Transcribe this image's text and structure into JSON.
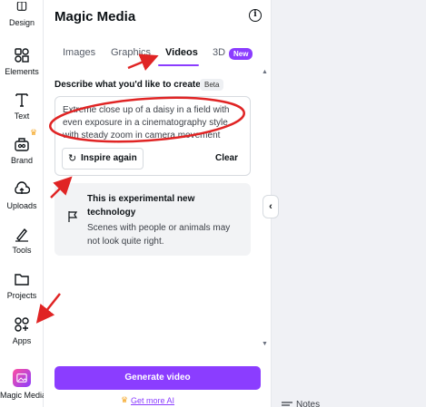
{
  "sidebar": {
    "items": [
      {
        "label": "Design",
        "icon": "design-icon"
      },
      {
        "label": "Elements",
        "icon": "elements-icon"
      },
      {
        "label": "Text",
        "icon": "text-icon"
      },
      {
        "label": "Brand",
        "icon": "brand-icon"
      },
      {
        "label": "Uploads",
        "icon": "uploads-icon"
      },
      {
        "label": "Tools",
        "icon": "tools-icon"
      },
      {
        "label": "Projects",
        "icon": "projects-icon"
      },
      {
        "label": "Apps",
        "icon": "apps-icon"
      },
      {
        "label": "Magic Media",
        "icon": "magic-media-icon"
      }
    ]
  },
  "panel": {
    "title": "Magic Media",
    "tabs": [
      {
        "label": "Images",
        "active": false
      },
      {
        "label": "Graphics",
        "active": false
      },
      {
        "label": "Videos",
        "active": true
      },
      {
        "label": "3D",
        "active": false
      }
    ],
    "new_badge": "New",
    "describe_label": "Describe what you'd like to create",
    "beta_badge": "Beta",
    "prompt_text": "Extreme close up of a daisy in a field with even exposure in a cinematography style with steady zoom in camera movement",
    "inspire_label": "Inspire again",
    "clear_label": "Clear",
    "experimental_title": "This is experimental new technology",
    "experimental_body": "Scenes with people or animals may not look quite right.",
    "generate_label": "Generate video",
    "get_more_label": "Get more AI"
  },
  "canvas": {
    "notes_label": "Notes"
  },
  "colors": {
    "accent": "#8b3dff",
    "annotation": "#e02424",
    "premium": "#f5a623"
  }
}
